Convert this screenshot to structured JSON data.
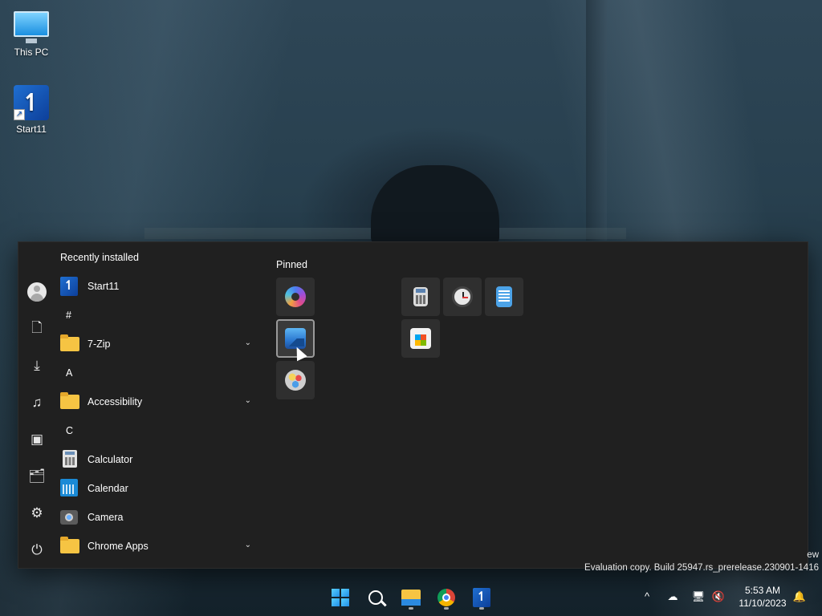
{
  "desktop": {
    "icons": [
      {
        "label": "This PC"
      },
      {
        "label": "Start11"
      }
    ]
  },
  "start_menu": {
    "recently_installed_header": "Recently installed",
    "apps": [
      {
        "label": "Start11"
      },
      {
        "letter": "#"
      },
      {
        "label": "7-Zip"
      },
      {
        "letter": "A"
      },
      {
        "label": "Accessibility"
      },
      {
        "letter": "C"
      },
      {
        "label": "Calculator"
      },
      {
        "label": "Calendar"
      },
      {
        "label": "Camera"
      },
      {
        "label": "Chrome Apps"
      }
    ],
    "pinned_header": "Pinned"
  },
  "watermark": {
    "line1": "ew",
    "line2": "Evaluation copy. Build 25947.rs_prerelease.230901-1416"
  },
  "taskbar": {
    "clock_time": "5:53 AM",
    "clock_date": "11/10/2023",
    "tray_chevron": "^"
  },
  "colors": {
    "start_bg": "#202020",
    "tile_bg": "#2f2f2f",
    "accent": "#1f8ee8"
  }
}
